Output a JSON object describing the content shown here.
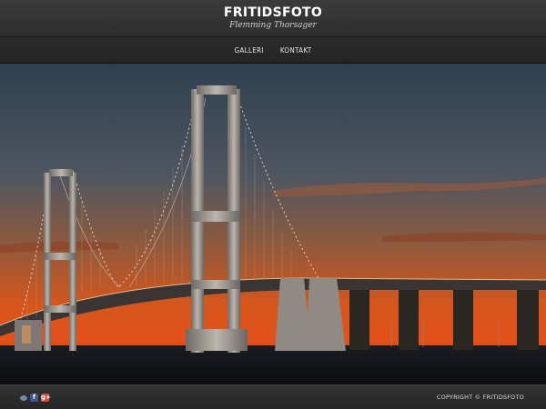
{
  "header": {
    "title": "FRITIDSFOTO",
    "subtitle": "Flemming Thorsager"
  },
  "nav": {
    "items": [
      {
        "label": "GALLERI"
      },
      {
        "label": "KONTAKT"
      }
    ]
  },
  "hero": {
    "image": "bridge-sunset-photo"
  },
  "footer": {
    "social": [
      {
        "icon": "share-icon",
        "glyph": ""
      },
      {
        "icon": "facebook-icon",
        "glyph": "f"
      },
      {
        "icon": "google-plus-icon",
        "glyph": "g+"
      }
    ],
    "copyright": "COPYRIGHT © FRITIDSFOTO"
  },
  "colors": {
    "header_bg": "#333333",
    "sky_top": "#2e4152",
    "sky_horizon": "#e0551a"
  }
}
